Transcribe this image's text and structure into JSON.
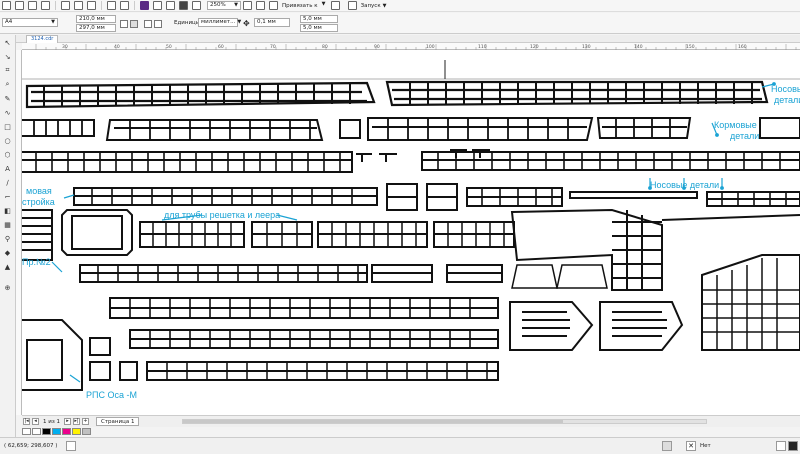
{
  "toolbar": {
    "paper_size": "A4",
    "zoom": "250%",
    "snap_label": "Привязать к",
    "launch_label": "Запуск"
  },
  "properties": {
    "width": "210,0 мм",
    "height": "297,0 мм",
    "units_label": "Единицы:",
    "units_value": "миллимет...",
    "nudge": "0,1 мм",
    "dup_x": "5,0 мм",
    "dup_y": "5,0 мм"
  },
  "document": {
    "tab_label": "3124.cdr"
  },
  "ruler": {
    "ticks": [
      "30",
      "40",
      "50",
      "60",
      "70",
      "80",
      "90",
      "100",
      "110",
      "120",
      "130",
      "140",
      "150",
      "160"
    ]
  },
  "canvas_labels": {
    "nose_top": "Носовые",
    "nose_top2": "детали",
    "stern": "Кормовые",
    "stern2": "детали",
    "nose_mid": "Носовые детали",
    "super1": "мовая",
    "super2": "стройка",
    "pipe": "для трубы решетка и леера",
    "pr2": "Пр.№2",
    "rps": "РПС Оса -М"
  },
  "pagebar": {
    "page_of": "1 из 1",
    "page_tab": "Страница 1"
  },
  "palette": {
    "colors": [
      "#ffffff",
      "#000000",
      "#00aeef",
      "#ec008c",
      "#fff200",
      "#c0c0c0"
    ]
  },
  "status": {
    "coords": "( 62,659; 298,607 )",
    "fill_label": "Нет"
  },
  "accent": "#1ba3d4"
}
